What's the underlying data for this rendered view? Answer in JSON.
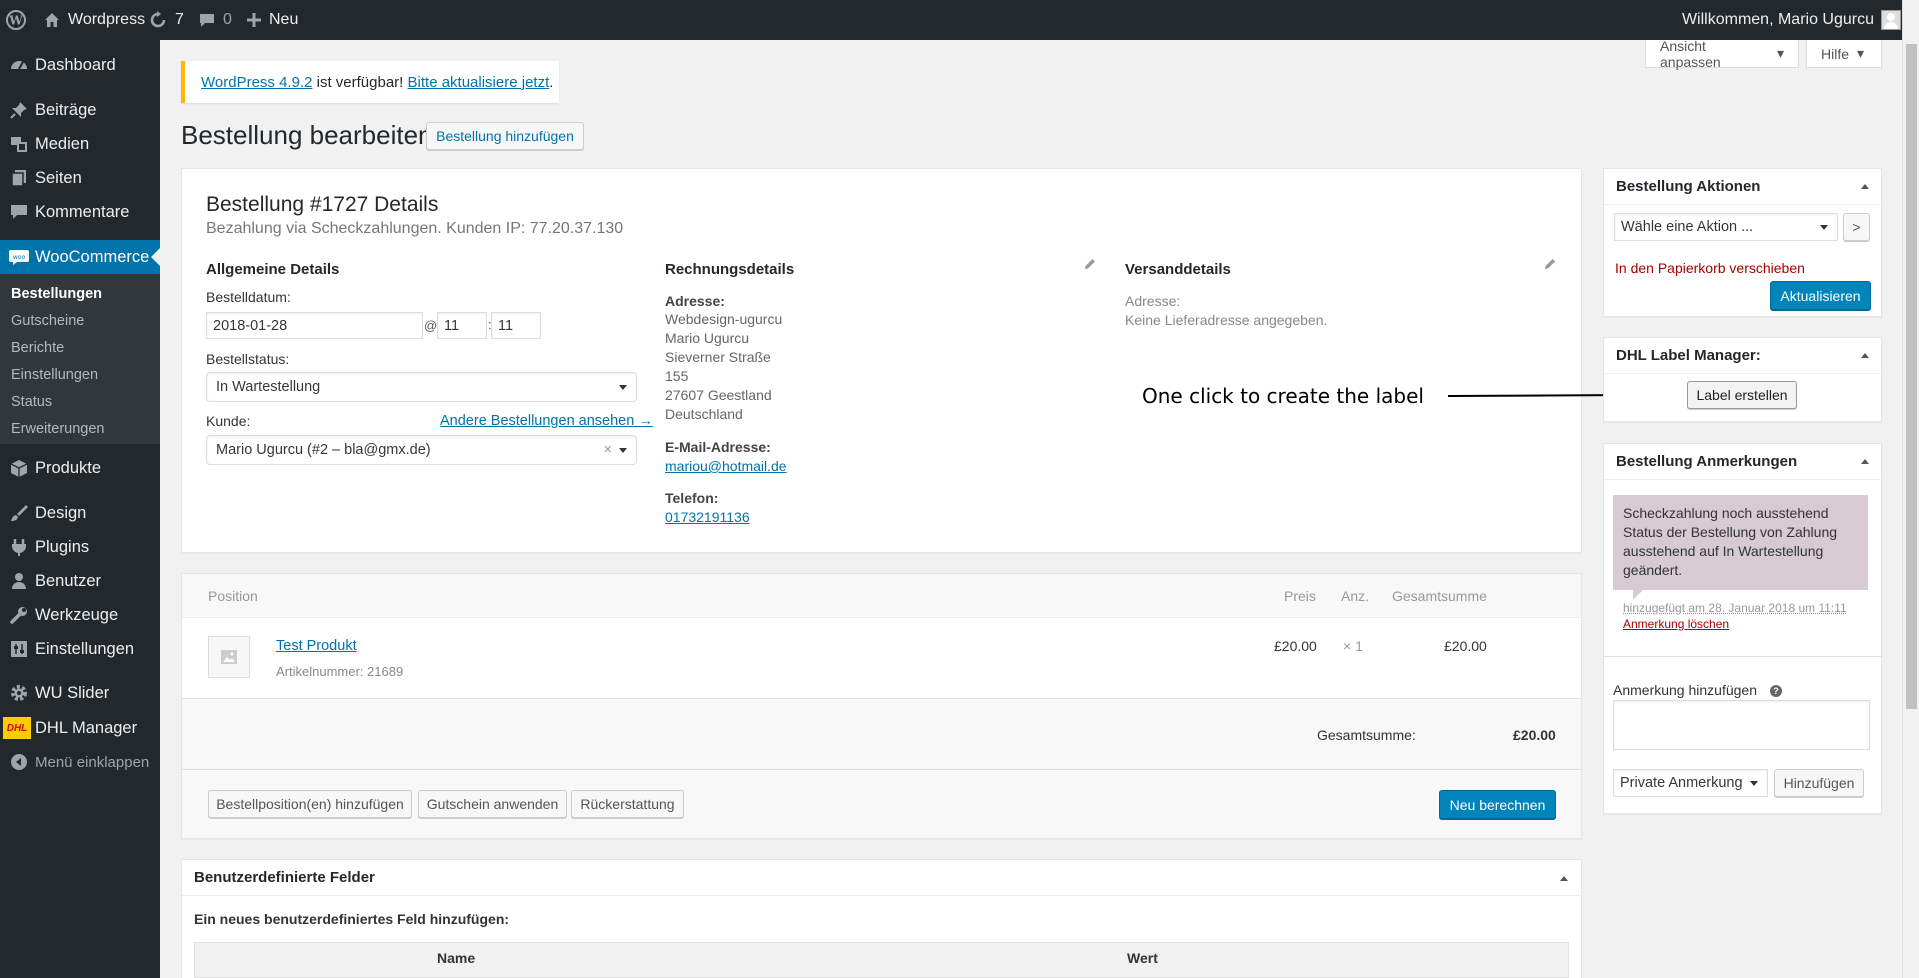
{
  "admin_bar": {
    "site_name": "Wordpress",
    "updates_count": "7",
    "comments_count": "0",
    "new_label": "Neu",
    "greeting": "Willkommen, Mario Ugurcu"
  },
  "sidebar": {
    "items": [
      {
        "label": "Dashboard",
        "icon": "dashboard-icon"
      },
      {
        "label": "Beiträge",
        "icon": "pin-icon"
      },
      {
        "label": "Medien",
        "icon": "media-icon"
      },
      {
        "label": "Seiten",
        "icon": "pages-icon"
      },
      {
        "label": "Kommentare",
        "icon": "comments-icon"
      },
      {
        "label": "WooCommerce",
        "icon": "woocommerce-icon"
      },
      {
        "label": "Produkte",
        "icon": "products-icon"
      },
      {
        "label": "Design",
        "icon": "brush-icon"
      },
      {
        "label": "Plugins",
        "icon": "plugins-icon"
      },
      {
        "label": "Benutzer",
        "icon": "users-icon"
      },
      {
        "label": "Werkzeuge",
        "icon": "wrench-icon"
      },
      {
        "label": "Einstellungen",
        "icon": "settings-icon"
      },
      {
        "label": "WU Slider",
        "icon": "gear-icon"
      },
      {
        "label": "DHL Manager",
        "icon": "dhl-logo-icon"
      },
      {
        "label": "Menü einklappen",
        "icon": "collapse-icon"
      }
    ],
    "woo_submenu": [
      "Bestellungen",
      "Gutscheine",
      "Berichte",
      "Einstellungen",
      "Status",
      "Erweiterungen"
    ],
    "dhl_logo_text": "DHL"
  },
  "screen_meta": {
    "screen_options": "Ansicht anpassen",
    "help": "Hilfe"
  },
  "notice": {
    "version_link": "WordPress 4.9.2",
    "middle": "ist verfügbar!",
    "update_link": "Bitte aktualisiere jetzt",
    "end": "."
  },
  "page": {
    "title": "Bestellung bearbeiten",
    "add_button": "Bestellung hinzufügen"
  },
  "order": {
    "heading": "Bestellung #1727 Details",
    "subheading": "Bezahlung via Scheckzahlungen. Kunden IP: 77.20.37.130",
    "general": {
      "title": "Allgemeine Details",
      "date_label": "Bestelldatum:",
      "date_value": "2018-01-28",
      "at": "@",
      "hour": "11",
      "colon": ":",
      "minute": "11",
      "status_label": "Bestellstatus:",
      "status_value": "In Wartestellung",
      "customer_label": "Kunde:",
      "other_orders_link": "Andere Bestellungen ansehen →",
      "customer_value": "Mario Ugurcu (#2 – bla@gmx.de)",
      "clear": "×"
    },
    "billing": {
      "title": "Rechnungsdetails",
      "address_label": "Adresse:",
      "address_lines": [
        "Webdesign-ugurcu",
        "Mario Ugurcu",
        "Sieverner Straße",
        "155",
        "27607 Geestland",
        "Deutschland"
      ],
      "email_label": "E-Mail-Adresse:",
      "email": "mariou@hotmail.de",
      "phone_label": "Telefon:",
      "phone": "01732191136"
    },
    "shipping": {
      "title": "Versanddetails",
      "address_label": "Adresse:",
      "address_value": "Keine Lieferadresse angegeben."
    }
  },
  "items": {
    "headers": {
      "position": "Position",
      "price": "Preis",
      "qty": "Anz.",
      "total": "Gesamtsumme"
    },
    "rows": [
      {
        "name": "Test Produkt",
        "sku": "Artikelnummer: 21689",
        "price": "£20.00",
        "qty": "× 1",
        "total": "£20.00"
      }
    ],
    "grand_total_label": "Gesamtsumme:",
    "grand_total": "£20.00",
    "buttons": {
      "add_items": "Bestellposition(en) hinzufügen",
      "apply_coupon": "Gutschein anwenden",
      "refund": "Rückerstattung",
      "recalculate": "Neu berechnen"
    }
  },
  "custom_fields": {
    "title": "Benutzerdefinierte Felder",
    "subtitle": "Ein neues benutzerdefiniertes Feld hinzufügen:",
    "col_name": "Name",
    "col_value": "Wert"
  },
  "actions_box": {
    "title": "Bestellung Aktionen",
    "select_value": "Wähle eine Aktion ...",
    "go": ">",
    "trash_link": "In den Papierkorb verschieben",
    "update_button": "Aktualisieren"
  },
  "dhl_box": {
    "title": "DHL Label Manager:",
    "button": "Label erstellen"
  },
  "notes_box": {
    "title": "Bestellung Anmerkungen",
    "note_text": "Scheckzahlung noch ausstehend Status der Bestellung von Zahlung ausstehend auf In Wartestellung geändert.",
    "note_meta": "hinzugefügt am 28. Januar 2018 um 11:11",
    "delete_link": "Anmerkung löschen",
    "add_label": "Anmerkung hinzufügen",
    "help": "?",
    "type_value": "Private Anmerkung",
    "add_button": "Hinzufügen"
  },
  "annotation": {
    "text": "One click to create the label"
  }
}
